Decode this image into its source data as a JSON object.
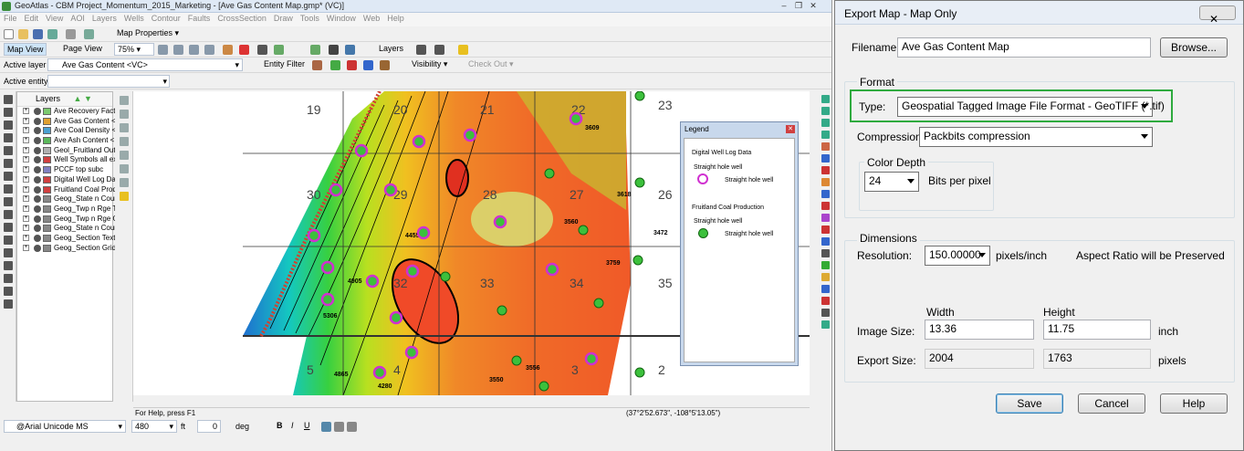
{
  "app": {
    "title": "GeoAtlas - CBM Project_Momentum_2015_Marketing - [Ave Gas Content Map.gmp* (VC)]",
    "menu": [
      "File",
      "Edit",
      "View",
      "AOI",
      "Layers",
      "Wells",
      "Contour",
      "Faults",
      "CrossSection",
      "Draw",
      "Tools",
      "Window",
      "Web",
      "Help"
    ],
    "toolbar1": {
      "map_properties": "Map Properties"
    },
    "toolbar2": {
      "map_view": "Map View",
      "page_view": "Page View",
      "zoom": "75%",
      "layers": "Layers"
    },
    "toolbar3": {
      "active_layer_label": "Active layer",
      "active_layer_value": "Ave Gas Content <VC>",
      "entity_filter": "Entity Filter",
      "visibility": "Visibility",
      "check_out": "Check Out"
    },
    "active_entity": {
      "label": "Active entity",
      "value": ""
    },
    "layers_panel": {
      "title": "Layers",
      "items": [
        {
          "name": "Ave Recovery Fact",
          "swatch": "#7bc96f"
        },
        {
          "name": "Ave Gas Content <",
          "swatch": "#e0a030"
        },
        {
          "name": "Ave Coal Density <",
          "swatch": "#4aa0d0"
        },
        {
          "name": "Ave Ash Content <",
          "swatch": "#5cb85c"
        },
        {
          "name": "Geol_Fruitland Outc",
          "swatch": "#b0b0b0"
        },
        {
          "name": "Well Symbols all exc",
          "swatch": "#d04040"
        },
        {
          "name": "PCCF top subc",
          "swatch": "#8080c0"
        },
        {
          "name": "Digital Well Log Dat",
          "swatch": "#d04040"
        },
        {
          "name": "Fruitland Coal Produ",
          "swatch": "#d04040"
        },
        {
          "name": "Geog_State n Cour",
          "swatch": "#888"
        },
        {
          "name": "Geog_Twp n Rge Te",
          "swatch": "#888"
        },
        {
          "name": "Geog_Twp n Rge G",
          "swatch": "#888"
        },
        {
          "name": "Geog_State n Cour",
          "swatch": "#888"
        },
        {
          "name": "Geog_Section Text",
          "swatch": "#888"
        },
        {
          "name": "Geog_Section Grid",
          "swatch": "#888"
        }
      ]
    },
    "map": {
      "sections": [
        "19",
        "20",
        "21",
        "22",
        "23",
        "30",
        "29",
        "28",
        "27",
        "26",
        "32",
        "33",
        "34",
        "35",
        "5",
        "4",
        "3",
        "2"
      ],
      "well_labels": [
        "3609",
        "3618",
        "3560",
        "3472",
        "3759",
        "4455",
        "4865",
        "4280",
        "4905",
        "3550",
        "5306",
        "3556"
      ]
    },
    "legend": {
      "title": "Legend",
      "group1": "Digital Well Log Data",
      "group1_sub": "Straight hole well",
      "group1_item": "Straight hole well",
      "group2": "Fruitland Coal Production",
      "group2_sub": "Straight hole well",
      "group2_item": "Straight hole well"
    },
    "status": {
      "help": "For Help, press F1",
      "coords": "(37°2'52.673\", -108°5'13.05\")"
    },
    "format_bar": {
      "font": "@Arial Unicode MS",
      "size": "480",
      "unit": "ft",
      "angle": "0",
      "angle_unit": "deg",
      "bold": "B",
      "italic": "I",
      "underline": "U"
    }
  },
  "dialog": {
    "title": "Export Map - Map Only",
    "close": "✕",
    "filename_label": "Filename:",
    "filename_value": "Ave Gas Content Map",
    "browse": "Browse...",
    "format_group": "Format",
    "type_label": "Type:",
    "type_value": "Geospatial Tagged Image File Format - GeoTIFF (*.tif)",
    "compression_label": "Compression:",
    "compression_value": "Packbits compression",
    "color_depth_group": "Color Depth",
    "color_depth_value": "24",
    "bits_per_pixel": "Bits per pixel",
    "dimensions_group": "Dimensions",
    "resolution_label": "Resolution:",
    "resolution_value": "150.00000",
    "pixels_per_inch": "pixels/inch",
    "aspect_note": "Aspect Ratio will be Preserved",
    "width_header": "Width",
    "height_header": "Height",
    "image_size_label": "Image Size:",
    "image_width": "13.36",
    "image_height": "11.75",
    "inch": "inch",
    "export_size_label": "Export Size:",
    "export_width": "2004",
    "export_height": "1763",
    "pixels": "pixels",
    "save": "Save",
    "cancel": "Cancel",
    "help": "Help"
  }
}
